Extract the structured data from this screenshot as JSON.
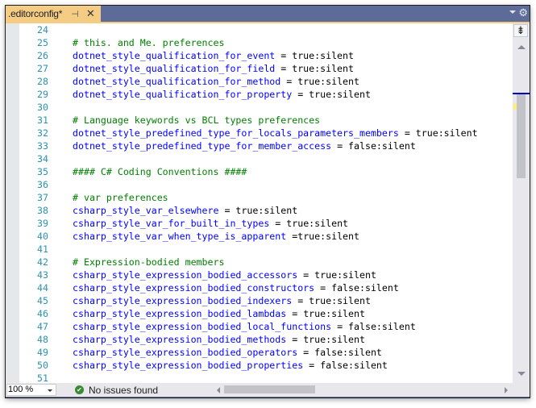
{
  "tab": {
    "title": ".editorconfig*",
    "pin_icon": "⊣",
    "close_icon": "✕"
  },
  "tabstrip": {
    "menu_icon": "chevron-down",
    "settings_icon": "⚙"
  },
  "editor": {
    "lines": [
      {
        "n": "24",
        "parts": []
      },
      {
        "n": "25",
        "parts": [
          {
            "t": "cmt",
            "s": "# this. and Me. preferences"
          }
        ]
      },
      {
        "n": "26",
        "parts": [
          {
            "t": "key",
            "s": "dotnet_style_qualification_for_event"
          },
          {
            "t": "val",
            "s": " = true:silent"
          }
        ]
      },
      {
        "n": "27",
        "parts": [
          {
            "t": "key",
            "s": "dotnet_style_qualification_for_field"
          },
          {
            "t": "val",
            "s": " = true:silent"
          }
        ]
      },
      {
        "n": "28",
        "parts": [
          {
            "t": "key",
            "s": "dotnet_style_qualification_for_method"
          },
          {
            "t": "val",
            "s": " = true:silent"
          }
        ]
      },
      {
        "n": "29",
        "parts": [
          {
            "t": "key",
            "s": "dotnet_style_qualification_for_property"
          },
          {
            "t": "val",
            "s": " = true:silent"
          }
        ]
      },
      {
        "n": "30",
        "parts": []
      },
      {
        "n": "31",
        "parts": [
          {
            "t": "cmt",
            "s": "# Language keywords vs BCL types preferences"
          }
        ]
      },
      {
        "n": "32",
        "parts": [
          {
            "t": "key",
            "s": "dotnet_style_predefined_type_for_locals_parameters_members"
          },
          {
            "t": "val",
            "s": " = true:silent"
          }
        ]
      },
      {
        "n": "33",
        "parts": [
          {
            "t": "key",
            "s": "dotnet_style_predefined_type_for_member_access"
          },
          {
            "t": "val",
            "s": " = false:silent"
          }
        ]
      },
      {
        "n": "34",
        "parts": []
      },
      {
        "n": "35",
        "parts": [
          {
            "t": "cmt",
            "s": "#### C# Coding Conventions ####"
          }
        ]
      },
      {
        "n": "36",
        "parts": []
      },
      {
        "n": "37",
        "parts": [
          {
            "t": "cmt",
            "s": "# var preferences"
          }
        ]
      },
      {
        "n": "38",
        "parts": [
          {
            "t": "key",
            "s": "csharp_style_var_elsewhere"
          },
          {
            "t": "val",
            "s": " = true:silent"
          }
        ]
      },
      {
        "n": "39",
        "parts": [
          {
            "t": "key",
            "s": "csharp_style_var_for_built_in_types"
          },
          {
            "t": "val",
            "s": " = true:silent"
          }
        ]
      },
      {
        "n": "40",
        "parts": [
          {
            "t": "key",
            "s": "csharp_style_var_when_type_is_apparent"
          },
          {
            "t": "val",
            "s": " =true:silent"
          }
        ]
      },
      {
        "n": "41",
        "parts": []
      },
      {
        "n": "42",
        "parts": [
          {
            "t": "cmt",
            "s": "# Expression-bodied members"
          }
        ]
      },
      {
        "n": "43",
        "parts": [
          {
            "t": "key",
            "s": "csharp_style_expression_bodied_accessors"
          },
          {
            "t": "val",
            "s": " = true:silent"
          }
        ]
      },
      {
        "n": "44",
        "parts": [
          {
            "t": "key",
            "s": "csharp_style_expression_bodied_constructors"
          },
          {
            "t": "val",
            "s": " = false:silent"
          }
        ]
      },
      {
        "n": "45",
        "parts": [
          {
            "t": "key",
            "s": "csharp_style_expression_bodied_indexers"
          },
          {
            "t": "val",
            "s": " = true:silent"
          }
        ]
      },
      {
        "n": "46",
        "parts": [
          {
            "t": "key",
            "s": "csharp_style_expression_bodied_lambdas"
          },
          {
            "t": "val",
            "s": " = true:silent"
          }
        ]
      },
      {
        "n": "47",
        "parts": [
          {
            "t": "key",
            "s": "csharp_style_expression_bodied_local_functions"
          },
          {
            "t": "val",
            "s": " = false:silent"
          }
        ]
      },
      {
        "n": "48",
        "parts": [
          {
            "t": "key",
            "s": "csharp_style_expression_bodied_methods"
          },
          {
            "t": "val",
            "s": " = true:silent"
          }
        ]
      },
      {
        "n": "49",
        "parts": [
          {
            "t": "key",
            "s": "csharp_style_expression_bodied_operators"
          },
          {
            "t": "val",
            "s": " = false:silent"
          }
        ]
      },
      {
        "n": "50",
        "parts": [
          {
            "t": "key",
            "s": "csharp_style_expression_bodied_properties"
          },
          {
            "t": "val",
            "s": " = false:silent"
          }
        ]
      },
      {
        "n": "51",
        "parts": []
      }
    ]
  },
  "scrollbar": {
    "split_icon": "⇟"
  },
  "statusbar": {
    "zoom_value": "100 %",
    "issues_icon": "✔",
    "issues_text": "No issues found"
  },
  "colors": {
    "tab_active": "#f5cc84",
    "chrome": "#5d6b99",
    "keyword": "#0000ff",
    "comment": "#008000",
    "line_number": "#2b91af"
  }
}
